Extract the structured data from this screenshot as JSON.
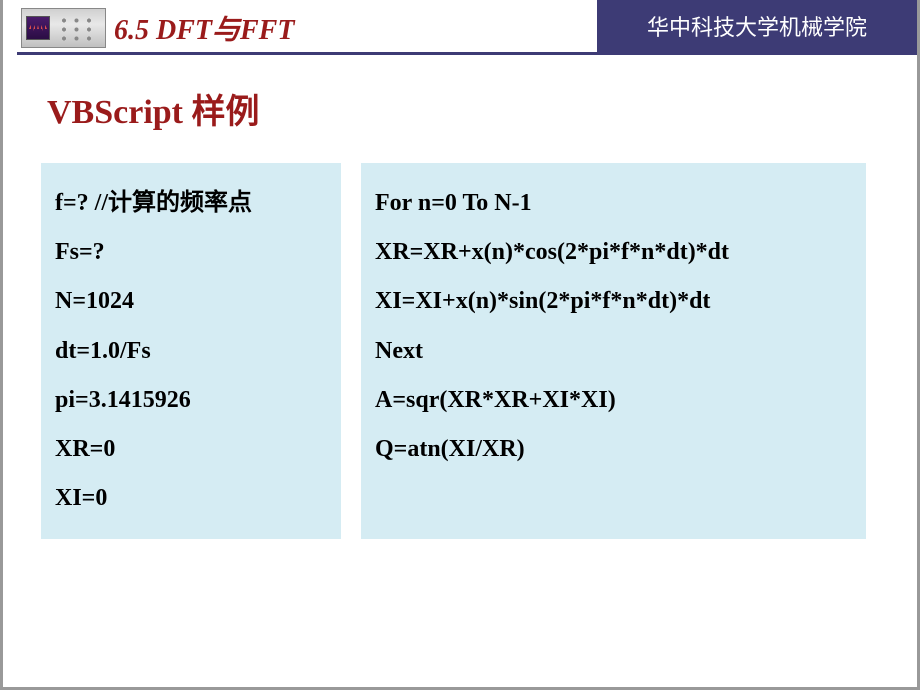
{
  "header": {
    "chapter_title": "6.5  DFT与FFT",
    "institution": "华中科技大学机械学院"
  },
  "content": {
    "slide_title": "VBScript 样例",
    "code_left": [
      "f=?   //计算的频率点",
      "Fs=?",
      "N=1024",
      "dt=1.0/Fs",
      "pi=3.1415926",
      "XR=0",
      "XI=0"
    ],
    "code_right": [
      "For n=0 To N-1",
      " XR=XR+x(n)*cos(2*pi*f*n*dt)*dt",
      " XI=XI+x(n)*sin(2*pi*f*n*dt)*dt",
      "Next",
      "A=sqr(XR*XR+XI*XI)",
      "Q=atn(XI/XR)"
    ]
  }
}
